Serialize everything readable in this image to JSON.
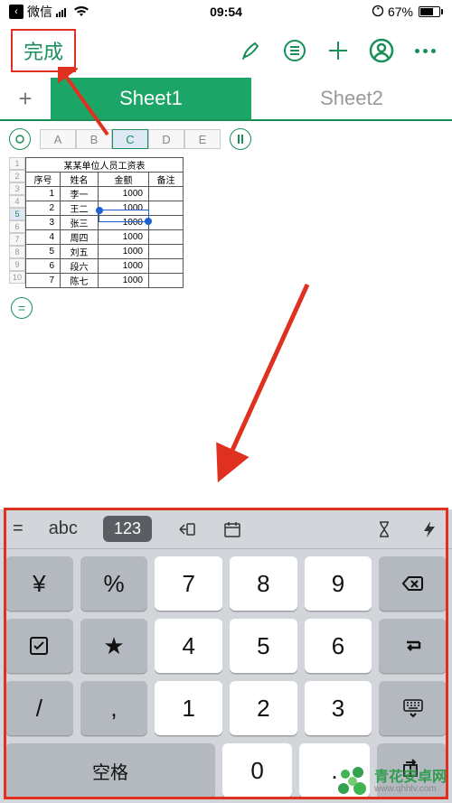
{
  "status": {
    "app": "微信",
    "time": "09:54",
    "battery_pct": "67%"
  },
  "toolbar": {
    "done": "完成"
  },
  "sheets": {
    "tabs": [
      "Sheet1",
      "Sheet2"
    ],
    "active": 0
  },
  "columns": [
    "A",
    "B",
    "C",
    "D",
    "E"
  ],
  "selected_col": "C",
  "selected_row": 5,
  "row_numbers": [
    1,
    2,
    3,
    4,
    5,
    6,
    7,
    8,
    9,
    10
  ],
  "table": {
    "title": "某某单位人员工资表",
    "headers": [
      "序号",
      "姓名",
      "金额",
      "备注"
    ],
    "rows": [
      {
        "n": "1",
        "name": "李一",
        "amt": "1000",
        "note": ""
      },
      {
        "n": "2",
        "name": "王二",
        "amt": "1000",
        "note": ""
      },
      {
        "n": "3",
        "name": "张三",
        "amt": "1000",
        "note": ""
      },
      {
        "n": "4",
        "name": "周四",
        "amt": "1000",
        "note": ""
      },
      {
        "n": "5",
        "name": "刘五",
        "amt": "1000",
        "note": ""
      },
      {
        "n": "6",
        "name": "段六",
        "amt": "1000",
        "note": ""
      },
      {
        "n": "7",
        "name": "陈七",
        "amt": "1000",
        "note": ""
      }
    ]
  },
  "keyboard_toolbar": {
    "eq": "=",
    "abc": "abc",
    "num": "123"
  },
  "keypad": {
    "row1": [
      "¥",
      "%",
      "7",
      "8",
      "9"
    ],
    "row2_fn_check": "☑",
    "row2_star": "★",
    "row2_nums": [
      "4",
      "5",
      "6"
    ],
    "row3_slash": "/",
    "row3_comma": ",",
    "row3_nums": [
      "1",
      "2",
      "3"
    ],
    "row4_space": "空格",
    "row4_zero": "0",
    "row4_dot": "."
  },
  "watermark": {
    "line1": "青花安卓网",
    "line2": "www.qhhlv.com"
  }
}
